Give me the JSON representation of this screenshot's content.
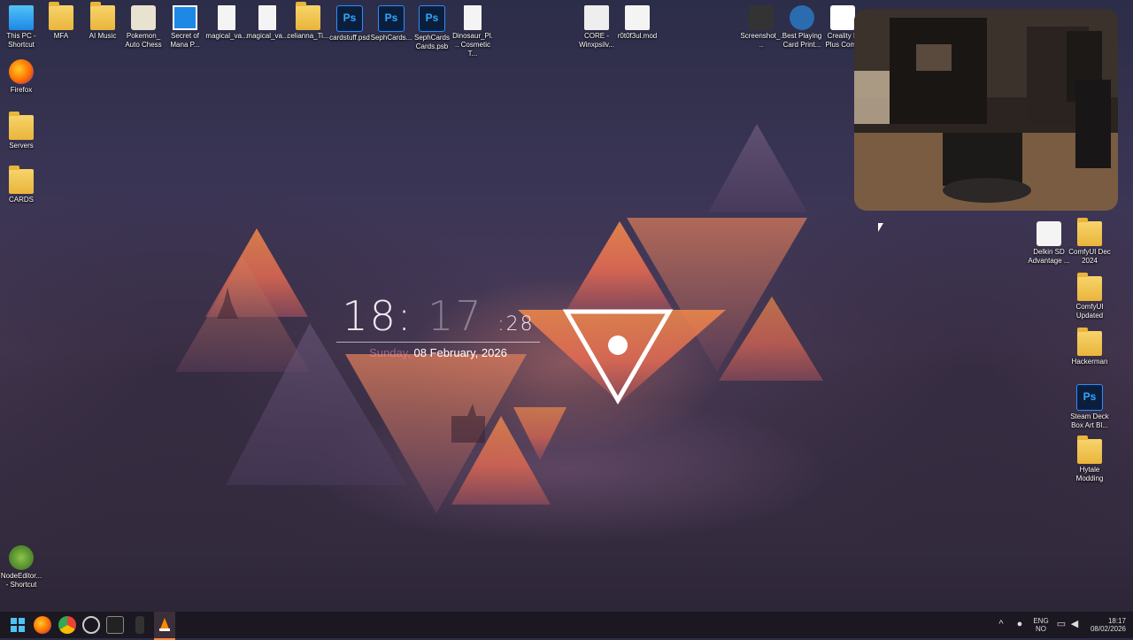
{
  "desktop": {
    "icons_top": [
      {
        "label": "This PC - Shortcut",
        "icon": "pc-icon"
      },
      {
        "label": "MFA",
        "icon": "folder-icon"
      },
      {
        "label": "AI Music",
        "icon": "folder-icon"
      },
      {
        "label": "Pokemon_ Auto Chess",
        "icon": "app-icon"
      },
      {
        "label": "Secret of Mana P...",
        "icon": "app-icon"
      },
      {
        "label": "magical_va...",
        "icon": "doc-icon"
      },
      {
        "label": "magical_va...",
        "icon": "doc-icon"
      },
      {
        "label": "celianna_Ti...",
        "icon": "folder-icon"
      },
      {
        "label": "cardstuff.psd",
        "icon": "photoshop-icon"
      },
      {
        "label": "SephCards...",
        "icon": "photoshop-icon"
      },
      {
        "label": "SephCards Cards.psb",
        "icon": "photoshop-icon"
      },
      {
        "label": "Dinosaur_Pl... Cosmetic T...",
        "icon": "doc-icon"
      },
      {
        "label": "CORE - Winxpsilv...",
        "icon": "app-icon"
      },
      {
        "label": "r0t0f3ul.mod",
        "icon": "media-icon"
      },
      {
        "label": "Screenshot_...",
        "icon": "image-icon"
      },
      {
        "label": "Best Playing Card Print...",
        "icon": "app-icon"
      },
      {
        "label": "Creality K Plus Comb",
        "icon": "app-icon"
      }
    ],
    "icons_left": [
      {
        "label": "Firefox",
        "icon": "firefox-icon"
      },
      {
        "label": "Servers",
        "icon": "folder-icon"
      },
      {
        "label": "CARDS",
        "icon": "folder-icon"
      },
      {
        "label": "NodeEditor... - Shortcut",
        "icon": "app-icon"
      }
    ],
    "icons_right": [
      {
        "label": "Delkin SD Advantage ...",
        "icon": "app-icon"
      },
      {
        "label": "ComfyUI Dec 2024",
        "icon": "folder-icon"
      },
      {
        "label": "ComfyUI Updated",
        "icon": "folder-icon"
      },
      {
        "label": "Hackerman",
        "icon": "folder-icon"
      },
      {
        "label": "Steam Deck Box Art Bl...",
        "icon": "photoshop-icon"
      },
      {
        "label": "Hytale Modding",
        "icon": "folder-icon"
      }
    ]
  },
  "clock_widget": {
    "hours": "18",
    "sep": ":",
    "minutes": "17",
    "seconds": ":28",
    "day": "Sunday,",
    "date": "08 February, 2026"
  },
  "taskbar": {
    "apps": [
      "start-icon",
      "firefox-icon",
      "chrome-icon",
      "settings-icon",
      "terminal-icon",
      "pin-icon",
      "vlc-icon"
    ],
    "lang_top": "ENG",
    "lang_bottom": "NO",
    "time": "18:17",
    "date": "08/02/2026"
  },
  "colors": {
    "accent": "#ff8a3d",
    "sunset": "#f08a4b",
    "dusk": "#4a3a56"
  }
}
